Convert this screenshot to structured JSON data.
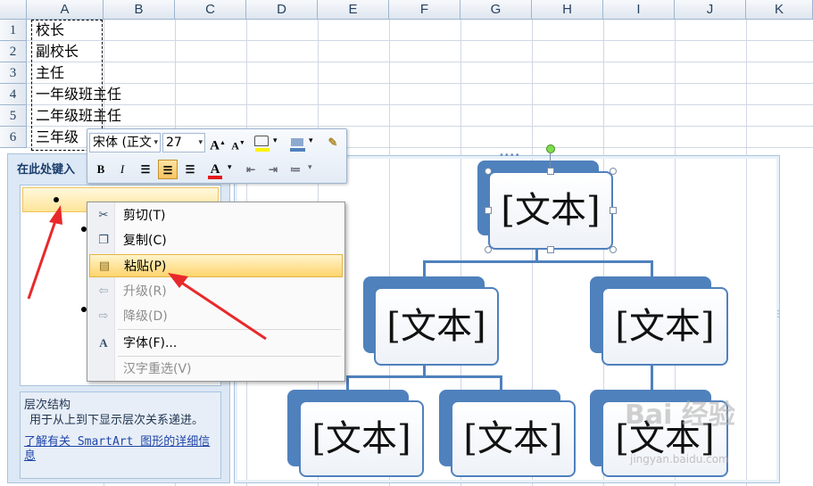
{
  "sheet": {
    "columns": [
      "A",
      "B",
      "C",
      "D",
      "E",
      "F",
      "G",
      "H",
      "I",
      "J",
      "K"
    ],
    "rows": [
      "1",
      "2",
      "3",
      "4",
      "5",
      "6"
    ],
    "cells": [
      "校长",
      "副校长",
      "主任",
      "一年级班主任",
      "二年级班主任",
      "三年级"
    ]
  },
  "text_pane": {
    "title": "在此处键入",
    "info_title": "层次结构",
    "info_desc": "用于从上到下显示层次关系递进。",
    "info_link": "了解有关 SmartArt 图形的详细信息"
  },
  "mini_toolbar": {
    "font_name": "宋体 (正文",
    "font_size": "27",
    "grow_font": "A",
    "shrink_font": "A",
    "bold": "B",
    "italic": "I",
    "font_color": "A"
  },
  "context_menu": {
    "items": [
      {
        "label": "剪切(T)",
        "icon": "scissors-icon",
        "enabled": true
      },
      {
        "label": "复制(C)",
        "icon": "copy-icon",
        "enabled": true
      },
      {
        "label": "粘贴(P)",
        "icon": "paste-icon",
        "enabled": true,
        "highlighted": true
      },
      {
        "label": "升级(R)",
        "icon": "promote-icon",
        "enabled": false
      },
      {
        "label": "降级(D)",
        "icon": "demote-icon",
        "enabled": false
      },
      {
        "label": "字体(F)...",
        "icon": "font-icon",
        "enabled": true
      },
      {
        "label": "汉字重选(V)",
        "icon": "",
        "enabled": false
      }
    ]
  },
  "smartart": {
    "nodes": [
      "[文本]",
      "[文本]",
      "[文本]",
      "[文本]",
      "[文本]",
      "[文本]"
    ]
  },
  "watermark": {
    "text": "Bai 经验",
    "url": "jingyan.baidu.com"
  },
  "colors": {
    "accent": "#4f81bd",
    "annotation_arrow": "#e8292b",
    "menu_highlight": "#fed46d"
  }
}
